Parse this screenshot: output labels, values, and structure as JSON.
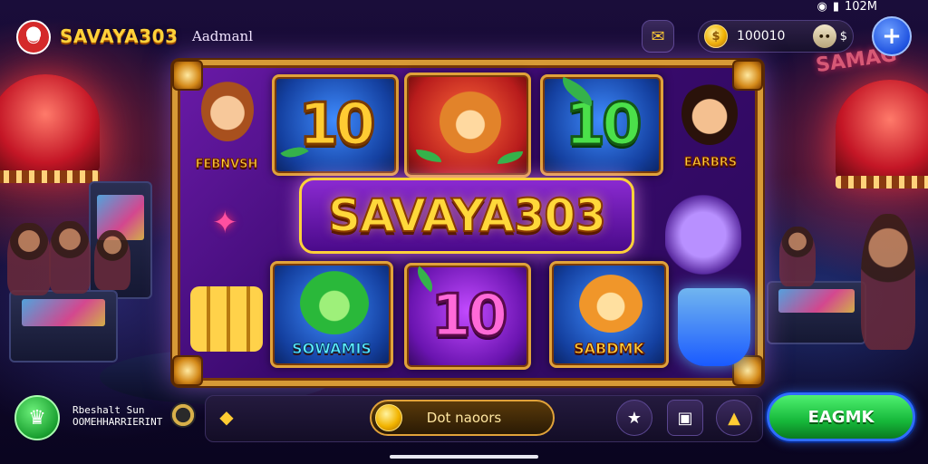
{
  "status_bar": {
    "time": "102M",
    "wifi_icon": "wifi-icon",
    "battery_icon": "battery-icon"
  },
  "header": {
    "brand": "SAVAYA303",
    "subtitle": "Aadmanl",
    "coin_balance": "100010",
    "chip_label": "$"
  },
  "slot": {
    "title": "SAVAYA303",
    "tiles": [
      {
        "label": "FEBNVSH",
        "symbol": ""
      },
      {
        "label": "",
        "symbol": "10"
      },
      {
        "label": "",
        "symbol": ""
      },
      {
        "label": "",
        "symbol": "10"
      },
      {
        "label": "EARBRS",
        "symbol": ""
      },
      {
        "label": "SOWAMIS",
        "symbol": ""
      },
      {
        "label": "",
        "symbol": "10"
      },
      {
        "label": "SABDMK",
        "symbol": ""
      }
    ]
  },
  "footer": {
    "cup_label_line1": "Rbeshalt Sun",
    "cup_label_line2": "OOMEHHARRIERINT",
    "spin_label": "Dot naoors",
    "action_label": "EAGMK"
  },
  "colors": {
    "gold": "#ffd23a",
    "green": "#16b83a",
    "blue": "#1f52e0",
    "purple": "#6a14b0"
  }
}
